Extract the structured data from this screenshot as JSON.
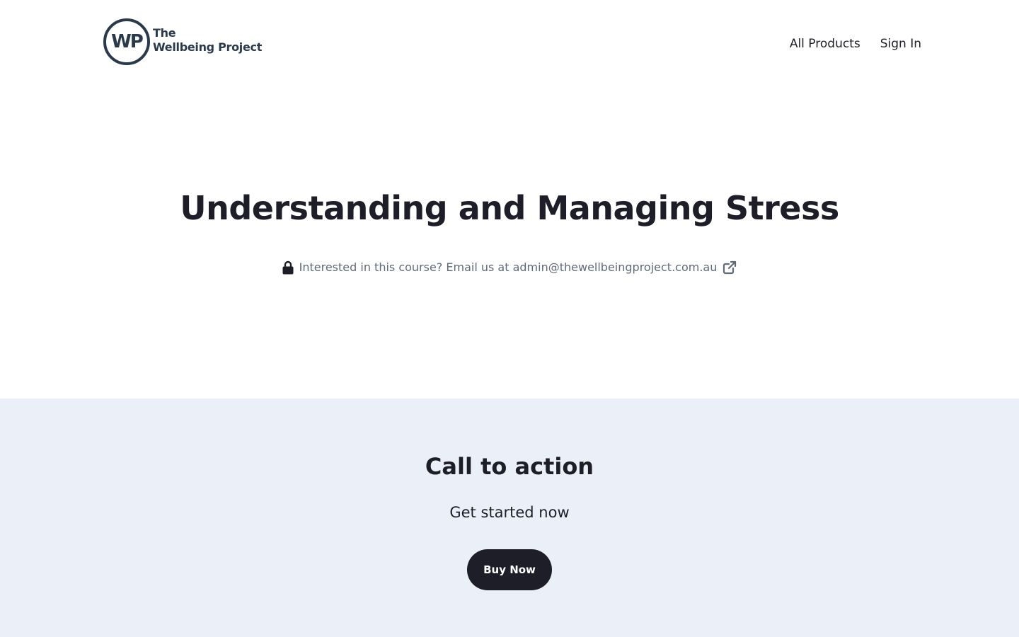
{
  "brand": {
    "logo_mark": "WP",
    "name_line1": "The",
    "name_line2": "Wellbeing Project",
    "color": "#2b3a4b"
  },
  "nav": {
    "items": [
      {
        "label": "All Products"
      },
      {
        "label": "Sign In"
      }
    ]
  },
  "hero": {
    "title": "Understanding and Managing Stress",
    "lock_icon": "lock-icon",
    "note": "Interested in this course? Email us at admin@thewellbeingproject.com.au",
    "link_icon": "external-link-icon"
  },
  "cta": {
    "title": "Call to action",
    "subtitle": "Get started now",
    "button_label": "Buy Now",
    "background": "#ebeff7",
    "button_color": "#1e1e28"
  }
}
